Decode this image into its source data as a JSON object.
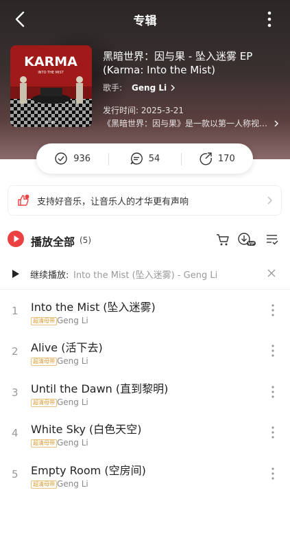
{
  "header": {
    "title": "专辑"
  },
  "album": {
    "title": "黑暗世界：因与果 - 坠入迷雾 EP (Karma: Into the Mist)",
    "singer_label": "歌手:",
    "singer_name": "Geng Li",
    "release": "发行时间: 2025-3-21",
    "description": "《黑暗世界：因与果》是一款以第一人称视角...",
    "cover_text": "KARMA",
    "cover_subtext": "INTO THE MIST",
    "cover_small": "Geng Li"
  },
  "stats": {
    "collect": "936",
    "comment": "54",
    "share": "170"
  },
  "banner": {
    "text": "支持好音乐，让音乐人的才华更有声响"
  },
  "playall": {
    "label": "播放全部",
    "count": "(5)"
  },
  "continue": {
    "label": "继续播放:",
    "song": "Into the Mist (坠入迷雾) - Geng Li"
  },
  "tracks": [
    {
      "index": "1",
      "title": "Into the Mist (坠入迷雾)",
      "quality": "超清母带",
      "artist": "Geng Li"
    },
    {
      "index": "2",
      "title": "Alive (活下去)",
      "quality": "超清母带",
      "artist": "Geng Li"
    },
    {
      "index": "3",
      "title": "Until the Dawn (直到黎明)",
      "quality": "超清母带",
      "artist": "Geng Li"
    },
    {
      "index": "4",
      "title": "White Sky (白色天空)",
      "quality": "超清母带",
      "artist": "Geng Li"
    },
    {
      "index": "5",
      "title": "Empty Room (空房间)",
      "quality": "超清母带",
      "artist": "Geng Li"
    }
  ],
  "colors": {
    "accent": "#ec4141",
    "quality": "#d79a2c"
  }
}
